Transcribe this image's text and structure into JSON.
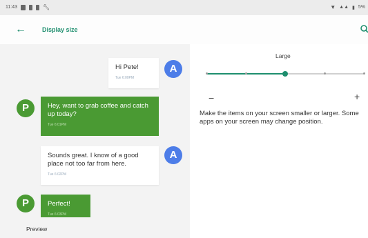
{
  "status_bar": {
    "time": "11:43",
    "left_icons": [
      "notification-icon",
      "notification-icon",
      "notification-icon",
      "wrench-icon"
    ],
    "right_icons": [
      "wifi-icon",
      "signal-icon",
      "battery-icon"
    ],
    "battery": "5%"
  },
  "app_bar": {
    "title": "Display size"
  },
  "preview": {
    "label": "Preview",
    "messages": [
      {
        "sender": "A",
        "side": "right",
        "text": "Hi Pete!",
        "time": "Tue 6:00PM"
      },
      {
        "sender": "P",
        "side": "left",
        "text": "Hey, want to grab coffee and catch up today?",
        "time": "Tue 6:01PM"
      },
      {
        "sender": "A",
        "side": "right",
        "text": "Sounds great. I know of a good place not too far from here.",
        "time": "Tue 6:02PM"
      },
      {
        "sender": "P",
        "side": "left",
        "text": "Perfect!",
        "time": "Tue 6:03PM"
      }
    ]
  },
  "settings": {
    "size_label": "Large",
    "slider_level": 3,
    "slider_steps": 5,
    "minus": "−",
    "plus": "+",
    "description": "Make the items on your screen smaller or larger. Some apps on your screen may change position."
  },
  "colors": {
    "accent": "#1e8e6e",
    "bubble_green": "#4a9a33",
    "avatar_blue": "#4d7de8"
  }
}
